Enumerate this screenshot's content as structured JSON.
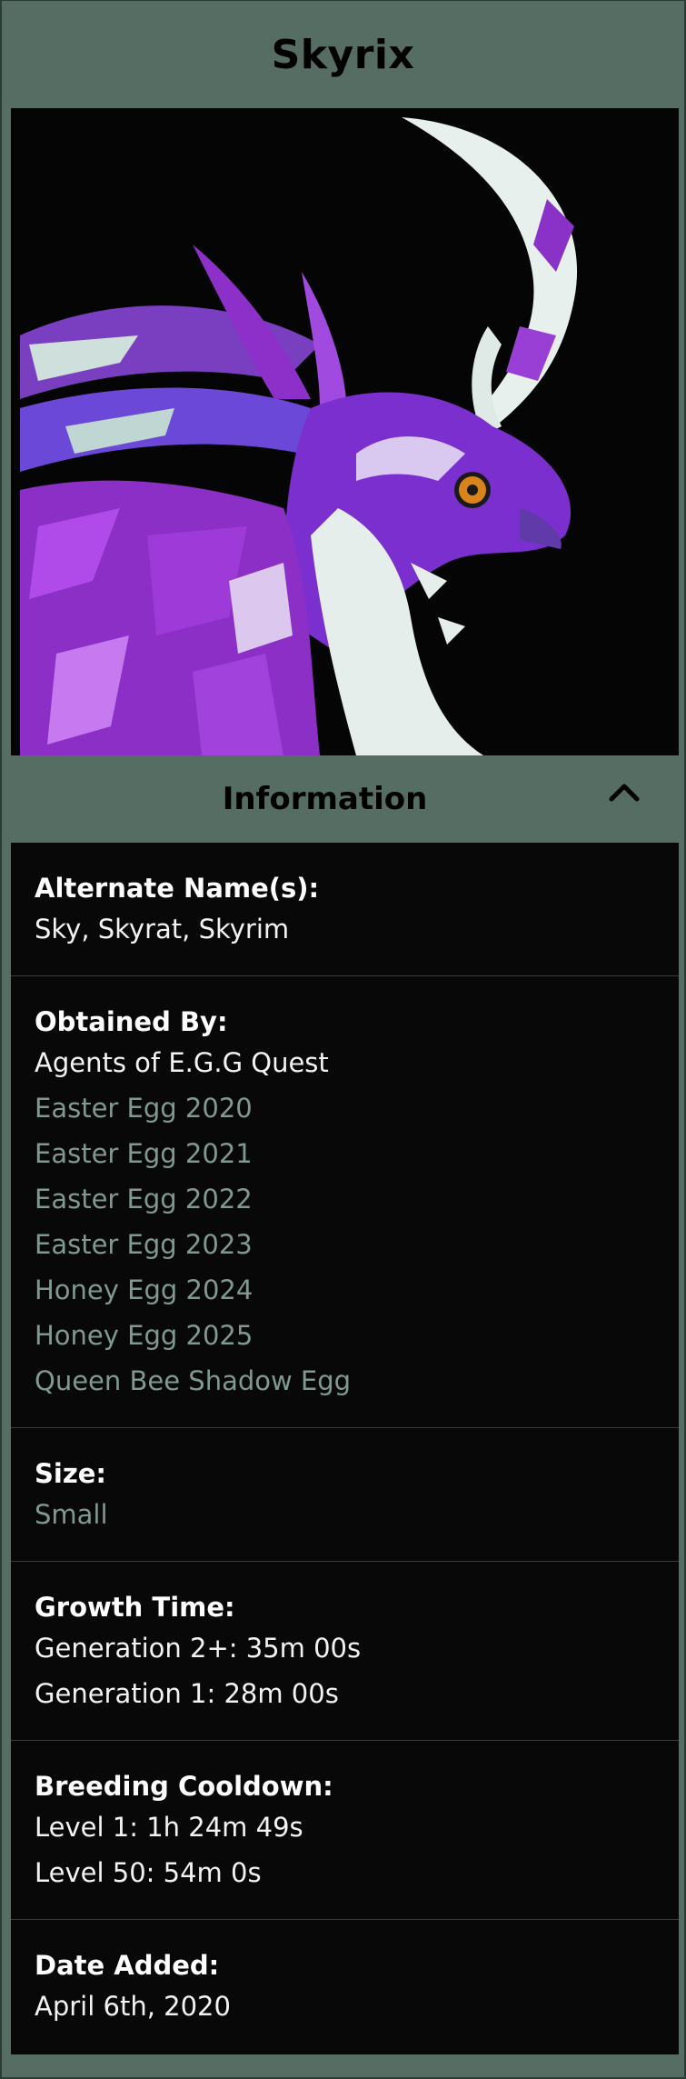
{
  "title": "Skyrix",
  "image": {
    "subject": "purple and white dragon head portrait"
  },
  "section": {
    "label": "Information",
    "toggle_icon": "chevron-up-icon"
  },
  "rows": {
    "alternate": {
      "label": "Alternate Name(s):",
      "value": "Sky, Skyrat, Skyrim"
    },
    "obtained": {
      "label": "Obtained By:",
      "plain": "Agents of E.G.G Quest",
      "links": [
        "Easter Egg 2020",
        "Easter Egg 2021",
        "Easter Egg 2022",
        "Easter Egg 2023",
        "Honey Egg 2024",
        "Honey Egg 2025",
        "Queen Bee Shadow Egg"
      ]
    },
    "size": {
      "label": "Size:",
      "value": "Small"
    },
    "growth": {
      "label": "Growth Time:",
      "lines": [
        "Generation 2+: 35m 00s",
        "Generation 1: 28m 00s"
      ]
    },
    "breeding": {
      "label": "Breeding Cooldown:",
      "lines": [
        "Level 1: 1h 24m 49s",
        "Level 50: 54m 0s"
      ]
    },
    "date": {
      "label": "Date Added:",
      "value": "April 6th, 2020"
    }
  },
  "colors": {
    "header_bg": "#566d63",
    "body_bg": "#080808",
    "link": "#7f9890"
  }
}
